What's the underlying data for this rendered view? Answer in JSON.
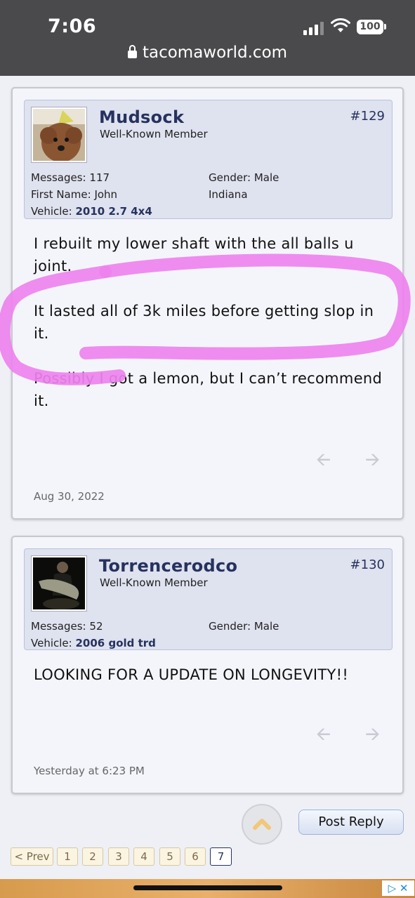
{
  "status_bar": {
    "time": "7:06",
    "battery": "100",
    "url": "tacomaworld.com"
  },
  "posts": [
    {
      "username": "Mudsock",
      "title": "Well-Known Member",
      "post_number": "#129",
      "stats": {
        "messages_label": "Messages:",
        "messages": "117",
        "first_name_label": "First Name:",
        "first_name": "John",
        "vehicle_label": "Vehicle:",
        "vehicle": "2010 2.7 4x4",
        "gender_label": "Gender:",
        "gender": "Male",
        "location": "Indiana"
      },
      "body": [
        "I rebuilt my lower shaft with the all balls u joint.",
        "It lasted all of 3k miles before getting slop in it.",
        "Possibly I got a lemon, but I can’t recommend it."
      ],
      "date": "Aug 30, 2022"
    },
    {
      "username": "Torrencerodco",
      "title": "Well-Known Member",
      "post_number": "#130",
      "stats": {
        "messages_label": "Messages:",
        "messages": "52",
        "vehicle_label": "Vehicle:",
        "vehicle": "2006 gold trd",
        "gender_label": "Gender:",
        "gender": "Male"
      },
      "body": [
        "LOOKING FOR A UPDATE ON LONGEVITY!!"
      ],
      "date": "Yesterday at 6:23 PM"
    }
  ],
  "actions": {
    "post_reply": "Post Reply"
  },
  "pagination": {
    "prev": "< Prev",
    "pages": [
      "1",
      "2",
      "3",
      "4",
      "5",
      "6",
      "7"
    ],
    "current": "7"
  },
  "colors": {
    "accent": "#26325e",
    "highlight_annotation": "#ee82ee"
  }
}
